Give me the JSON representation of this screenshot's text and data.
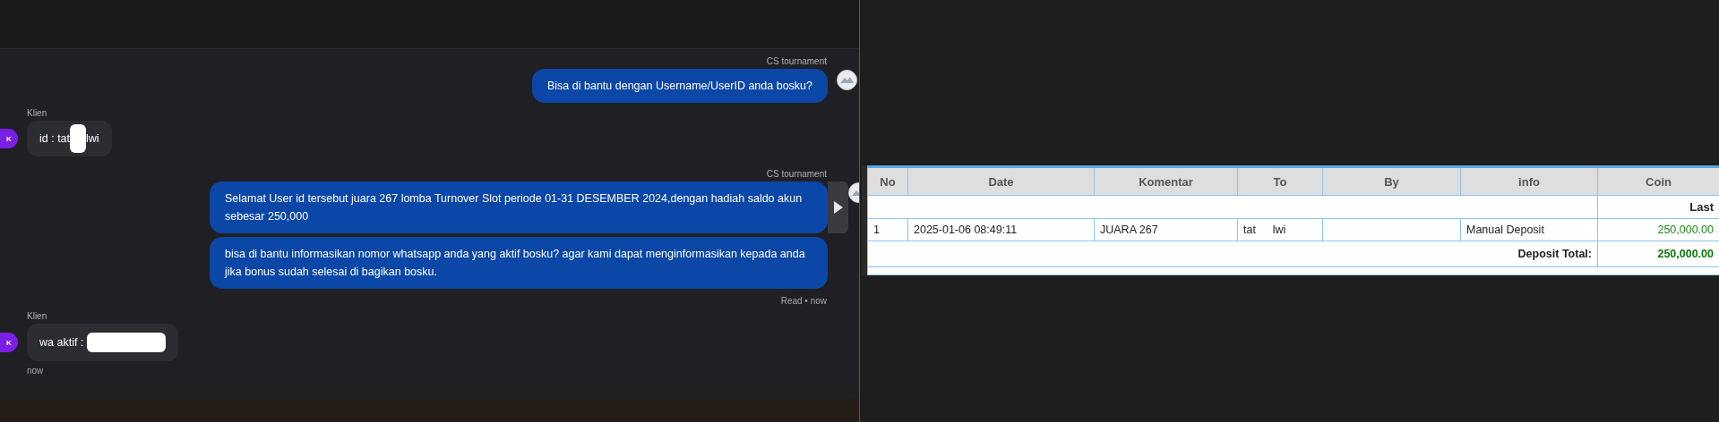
{
  "chat": {
    "messages": [
      {
        "kind": "agent",
        "sender": "CS tournament",
        "bubbles": [
          "Bisa di bantu dengan Username/UserID anda bosku?"
        ]
      },
      {
        "kind": "client",
        "sender": "Klien",
        "avatar": "K",
        "text": "id : tat",
        "redacted": true,
        "text_end": "lwi"
      },
      {
        "kind": "agent",
        "sender": "CS tournament",
        "bubbles": [
          "Selamat User id tersebut juara 267 lomba Turnover Slot periode 01-31 DESEMBER 2024,dengan hadiah saldo akun sebesar 250,000",
          "bisa di bantu informasikan nomor whatsapp anda yang aktif bosku? agar kami dapat menginformasikan kepada anda jika bonus sudah selesai di bagikan bosku."
        ],
        "play_button": true,
        "status": "Read • now"
      },
      {
        "kind": "client",
        "sender": "Klien",
        "avatar": "K",
        "text": "wa aktif :",
        "redacted": true,
        "time": "now"
      }
    ]
  },
  "table": {
    "columns": [
      "No",
      "Date",
      "Komentar",
      "To",
      "By",
      "info",
      "Coin"
    ],
    "rows": [
      {
        "kind": "label",
        "text": "Last"
      },
      {
        "kind": "entry",
        "cells": [
          {
            "text": "1"
          },
          {
            "text": "2025-01-06 08:49:11"
          },
          {
            "text": "JUARA 267"
          },
          {
            "text": "tat",
            "text_end": "lwi"
          },
          {},
          {
            "text": "Manual Deposit"
          },
          {
            "text": "250,000.00",
            "kind": "amount"
          }
        ]
      },
      {
        "kind": "total",
        "label": "Deposit Total:",
        "value": "250,000.00"
      },
      {
        "kind": "blank"
      }
    ]
  }
}
